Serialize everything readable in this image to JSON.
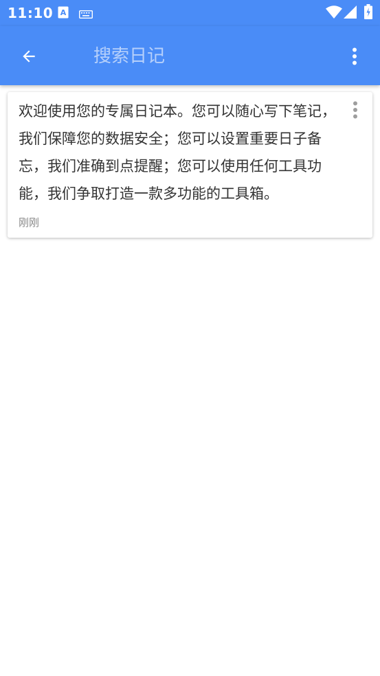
{
  "status_bar": {
    "time": "11:10",
    "icons": [
      "a11y-icon",
      "keyboard-icon",
      "wifi-icon",
      "signal-icon",
      "battery-icon"
    ]
  },
  "toolbar": {
    "search_placeholder": "搜索日记",
    "search_value": "",
    "back_icon": "arrow-left-icon",
    "more_icon": "more-vert-icon",
    "background_color": "#4a8cf7"
  },
  "notes": [
    {
      "content": "欢迎使用您的专属日记本。您可以随心写下笔记，我们保障您的数据安全；您可以设置重要日子备忘，我们准确到点提醒；您可以使用任何工具功能，我们争取打造一款多功能的工具箱。",
      "time": "刚刚",
      "menu_icon": "more-vert-icon"
    }
  ]
}
